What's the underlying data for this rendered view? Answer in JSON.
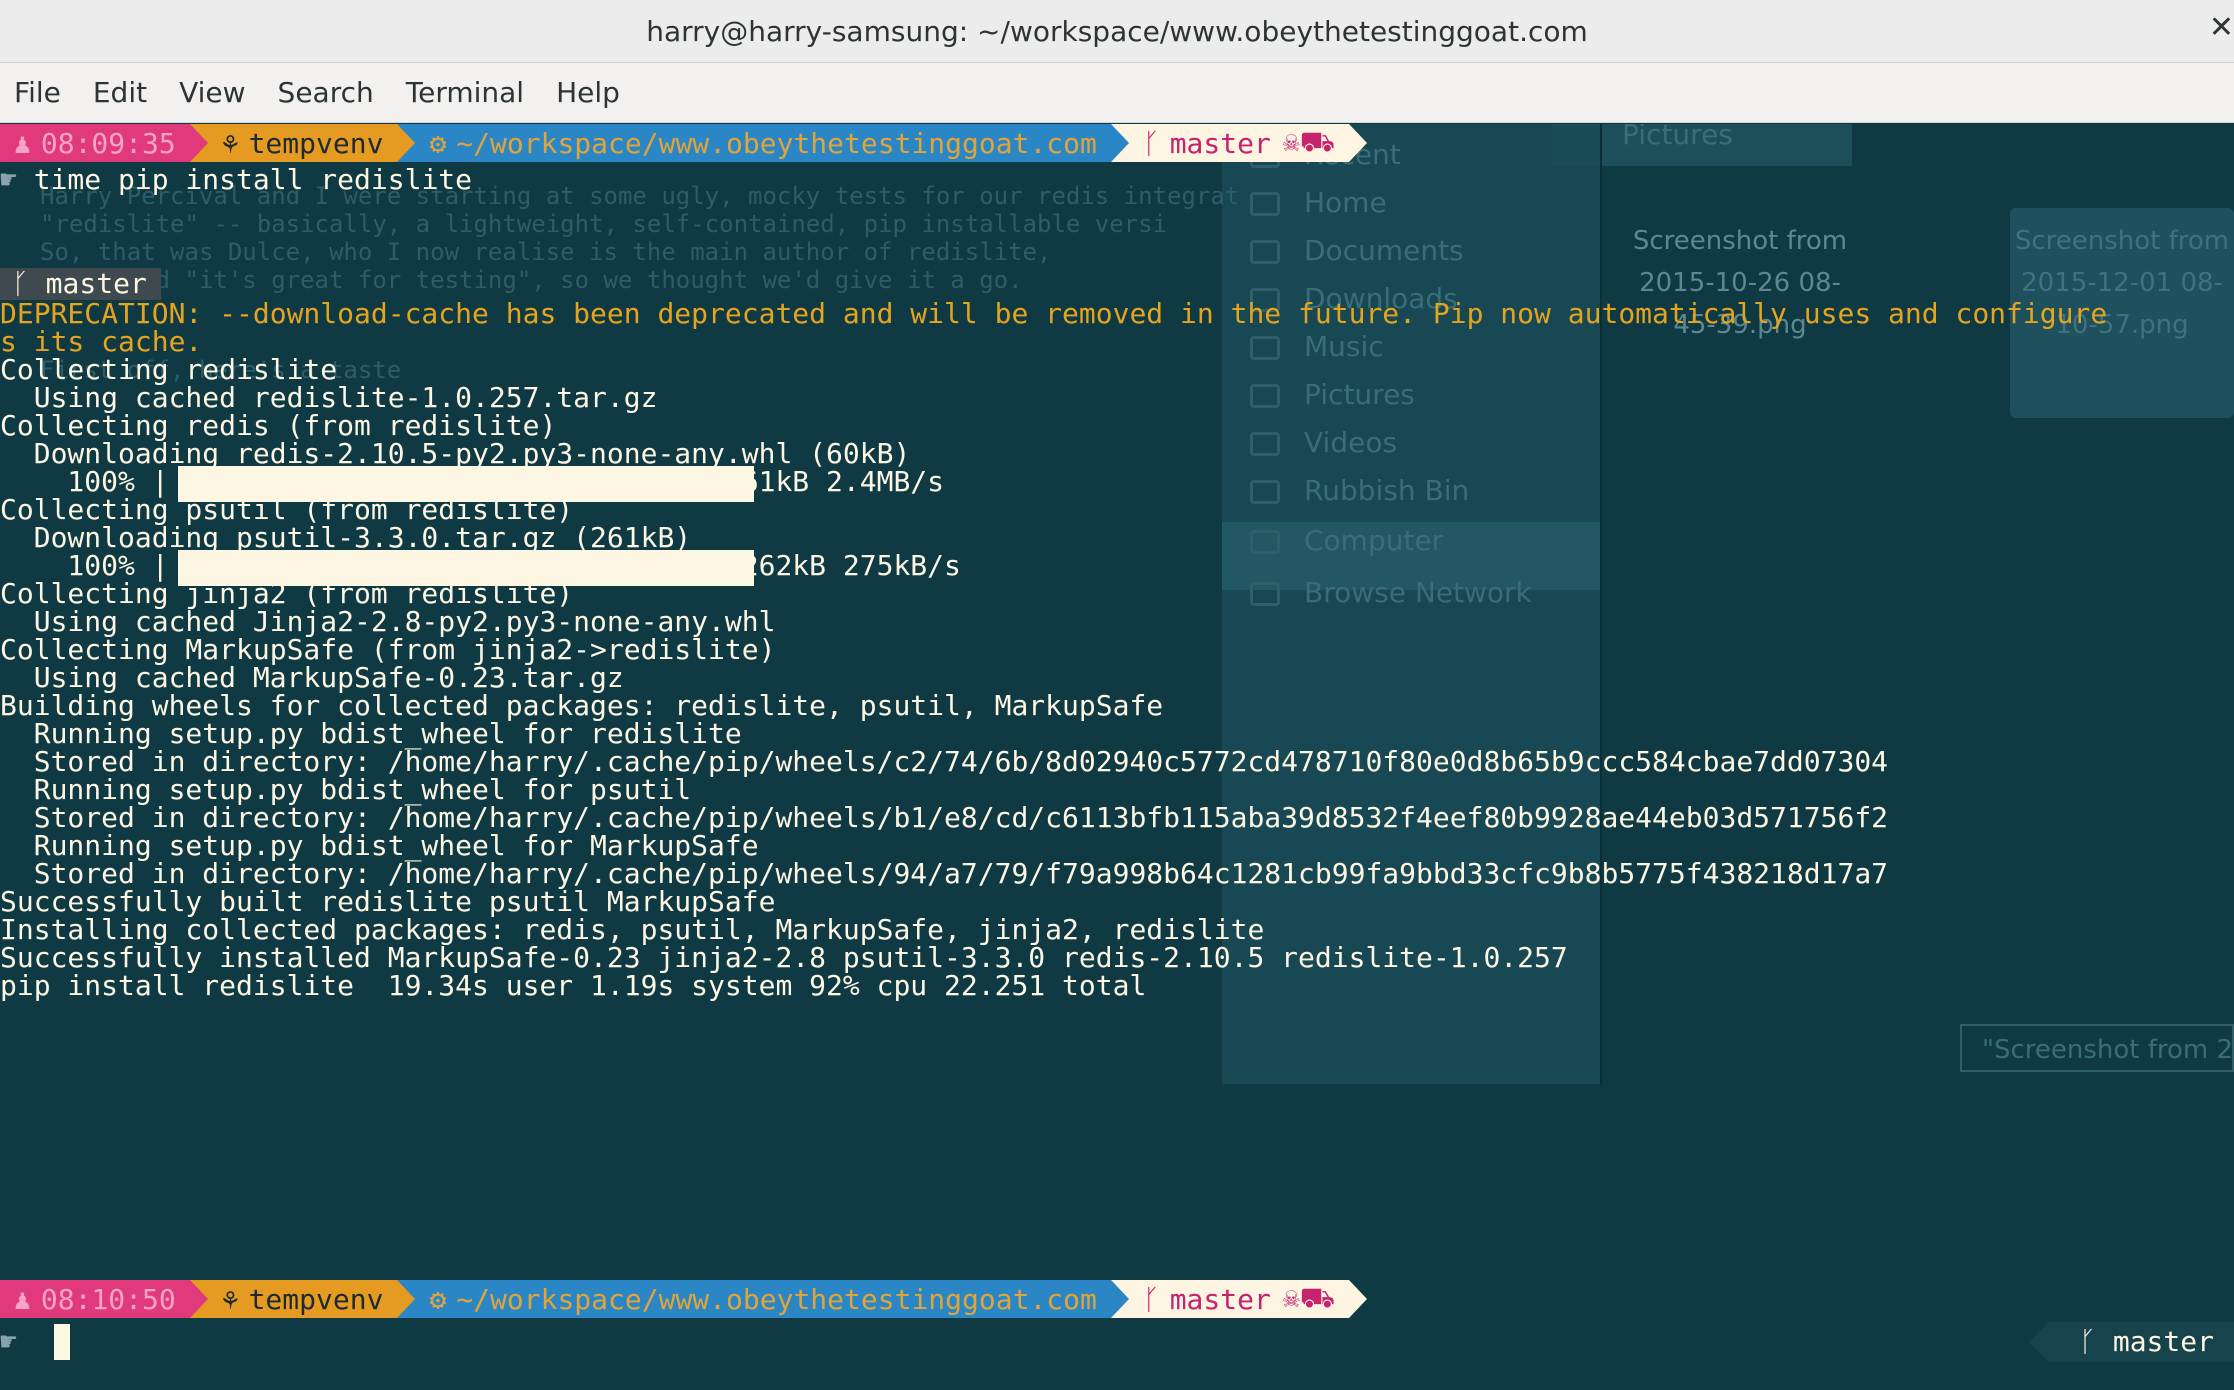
{
  "window": {
    "title": "harry@harry-samsung: ~/workspace/www.obeythetestinggoat.com"
  },
  "menu": [
    "File",
    "Edit",
    "View",
    "Search",
    "Terminal",
    "Help"
  ],
  "prompt1": {
    "time": "08:09:35",
    "venv": "tempvenv",
    "path": "~/workspace/www.obeythetestinggoat.com",
    "branch": "master"
  },
  "prompt2": {
    "time": "08:10:50",
    "venv": "tempvenv",
    "path": "~/workspace/www.obeythetestinggoat.com",
    "branch": "master"
  },
  "command": "time pip install redislite",
  "branch_pill": "master",
  "right_prompt": "master",
  "output": [
    {
      "text": "DEPRECATION: --download-cache has been deprecated and will be removed in the future. Pip now automatically uses and configure",
      "style": "warn"
    },
    {
      "text": "s its cache.",
      "style": "warn"
    },
    {
      "text": "Collecting redislite",
      "style": "normal"
    },
    {
      "text": "  Using cached redislite-1.0.257.tar.gz",
      "style": "normal"
    },
    {
      "text": "Collecting redis (from redislite)",
      "style": "normal"
    },
    {
      "text": "  Downloading redis-2.10.5-py2.py3-none-any.whl (60kB)",
      "style": "normal"
    },
    {
      "text": "    100% |                                | 61kB 2.4MB/s",
      "style": "normal"
    },
    {
      "text": "Collecting psutil (from redislite)",
      "style": "normal"
    },
    {
      "text": "  Downloading psutil-3.3.0.tar.gz (261kB)",
      "style": "normal"
    },
    {
      "text": "    100% |                                | 262kB 275kB/s",
      "style": "normal"
    },
    {
      "text": "Collecting jinja2 (from redislite)",
      "style": "normal"
    },
    {
      "text": "  Using cached Jinja2-2.8-py2.py3-none-any.whl",
      "style": "normal"
    },
    {
      "text": "Collecting MarkupSafe (from jinja2->redislite)",
      "style": "normal"
    },
    {
      "text": "  Using cached MarkupSafe-0.23.tar.gz",
      "style": "normal"
    },
    {
      "text": "Building wheels for collected packages: redislite, psutil, MarkupSafe",
      "style": "normal"
    },
    {
      "text": "  Running setup.py bdist_wheel for redislite",
      "style": "normal"
    },
    {
      "text": "  Stored in directory: /home/harry/.cache/pip/wheels/c2/74/6b/8d02940c5772cd478710f80e0d8b65b9ccc584cbae7dd07304",
      "style": "normal"
    },
    {
      "text": "  Running setup.py bdist_wheel for psutil",
      "style": "normal"
    },
    {
      "text": "  Stored in directory: /home/harry/.cache/pip/wheels/b1/e8/cd/c6113bfb115aba39d8532f4eef80b9928ae44eb03d571756f2",
      "style": "normal"
    },
    {
      "text": "  Running setup.py bdist_wheel for MarkupSafe",
      "style": "normal"
    },
    {
      "text": "  Stored in directory: /home/harry/.cache/pip/wheels/94/a7/79/f79a998b64c1281cb99fa9bbd33cfc9b8b5775f438218d17a7",
      "style": "normal"
    },
    {
      "text": "Successfully built redislite psutil MarkupSafe",
      "style": "normal"
    },
    {
      "text": "Installing collected packages: redis, psutil, MarkupSafe, jinja2, redislite",
      "style": "normal"
    },
    {
      "text": "Successfully installed MarkupSafe-0.23 jinja2-2.8 psutil-3.3.0 redis-2.10.5 redislite-1.0.257",
      "style": "normal"
    },
    {
      "text": "pip install redislite  19.34s user 1.19s system 92% cpu 22.251 total",
      "style": "normal"
    }
  ],
  "progress": [
    1.0,
    1.0
  ],
  "ghost": {
    "sidebar": [
      "Recent",
      "Home",
      "Documents",
      "Downloads",
      "Music",
      "Pictures",
      "Videos",
      "Rubbish Bin",
      "Computer",
      "Browse Network"
    ],
    "header": "Pictures",
    "thumb1": [
      "Screenshot from",
      "2015-10-26 08-",
      "45-39.png"
    ],
    "thumb2": [
      "Screenshot from",
      "2015-12-01 08-",
      "10-57.png"
    ],
    "rename": "\"Screenshot from 2",
    "faint_text": [
      "Harry Percival and I were starting at some ugly, mocky tests for our redis integrat",
      "\"redislite\" -- basically, a lightweight, self-contained, pip installable versi",
      "So, that was Dulce, who I now realise is the main author of redislite,",
      "he'd said \"it's great for testing\", so we thought we'd give it a go.",
      "First off, here's a taste"
    ]
  },
  "colors": {
    "background": "#0f3a44",
    "time_segment": "#e0397c",
    "venv_segment": "#e59b22",
    "path_segment": "#2b86c5",
    "git_segment": "#fdf4e2",
    "warning_text": "#e5a41e",
    "foreground": "#fdf6e3"
  }
}
